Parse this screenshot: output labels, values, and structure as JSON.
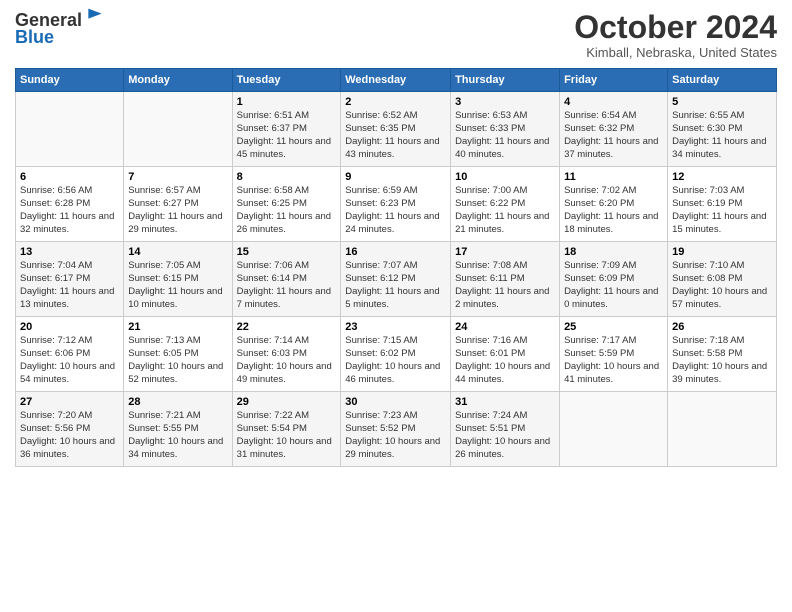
{
  "header": {
    "logo_line1": "General",
    "logo_line2": "Blue",
    "title": "October 2024",
    "location": "Kimball, Nebraska, United States"
  },
  "weekdays": [
    "Sunday",
    "Monday",
    "Tuesday",
    "Wednesday",
    "Thursday",
    "Friday",
    "Saturday"
  ],
  "weeks": [
    [
      {
        "num": "",
        "info": ""
      },
      {
        "num": "",
        "info": ""
      },
      {
        "num": "1",
        "info": "Sunrise: 6:51 AM\nSunset: 6:37 PM\nDaylight: 11 hours and 45 minutes."
      },
      {
        "num": "2",
        "info": "Sunrise: 6:52 AM\nSunset: 6:35 PM\nDaylight: 11 hours and 43 minutes."
      },
      {
        "num": "3",
        "info": "Sunrise: 6:53 AM\nSunset: 6:33 PM\nDaylight: 11 hours and 40 minutes."
      },
      {
        "num": "4",
        "info": "Sunrise: 6:54 AM\nSunset: 6:32 PM\nDaylight: 11 hours and 37 minutes."
      },
      {
        "num": "5",
        "info": "Sunrise: 6:55 AM\nSunset: 6:30 PM\nDaylight: 11 hours and 34 minutes."
      }
    ],
    [
      {
        "num": "6",
        "info": "Sunrise: 6:56 AM\nSunset: 6:28 PM\nDaylight: 11 hours and 32 minutes."
      },
      {
        "num": "7",
        "info": "Sunrise: 6:57 AM\nSunset: 6:27 PM\nDaylight: 11 hours and 29 minutes."
      },
      {
        "num": "8",
        "info": "Sunrise: 6:58 AM\nSunset: 6:25 PM\nDaylight: 11 hours and 26 minutes."
      },
      {
        "num": "9",
        "info": "Sunrise: 6:59 AM\nSunset: 6:23 PM\nDaylight: 11 hours and 24 minutes."
      },
      {
        "num": "10",
        "info": "Sunrise: 7:00 AM\nSunset: 6:22 PM\nDaylight: 11 hours and 21 minutes."
      },
      {
        "num": "11",
        "info": "Sunrise: 7:02 AM\nSunset: 6:20 PM\nDaylight: 11 hours and 18 minutes."
      },
      {
        "num": "12",
        "info": "Sunrise: 7:03 AM\nSunset: 6:19 PM\nDaylight: 11 hours and 15 minutes."
      }
    ],
    [
      {
        "num": "13",
        "info": "Sunrise: 7:04 AM\nSunset: 6:17 PM\nDaylight: 11 hours and 13 minutes."
      },
      {
        "num": "14",
        "info": "Sunrise: 7:05 AM\nSunset: 6:15 PM\nDaylight: 11 hours and 10 minutes."
      },
      {
        "num": "15",
        "info": "Sunrise: 7:06 AM\nSunset: 6:14 PM\nDaylight: 11 hours and 7 minutes."
      },
      {
        "num": "16",
        "info": "Sunrise: 7:07 AM\nSunset: 6:12 PM\nDaylight: 11 hours and 5 minutes."
      },
      {
        "num": "17",
        "info": "Sunrise: 7:08 AM\nSunset: 6:11 PM\nDaylight: 11 hours and 2 minutes."
      },
      {
        "num": "18",
        "info": "Sunrise: 7:09 AM\nSunset: 6:09 PM\nDaylight: 11 hours and 0 minutes."
      },
      {
        "num": "19",
        "info": "Sunrise: 7:10 AM\nSunset: 6:08 PM\nDaylight: 10 hours and 57 minutes."
      }
    ],
    [
      {
        "num": "20",
        "info": "Sunrise: 7:12 AM\nSunset: 6:06 PM\nDaylight: 10 hours and 54 minutes."
      },
      {
        "num": "21",
        "info": "Sunrise: 7:13 AM\nSunset: 6:05 PM\nDaylight: 10 hours and 52 minutes."
      },
      {
        "num": "22",
        "info": "Sunrise: 7:14 AM\nSunset: 6:03 PM\nDaylight: 10 hours and 49 minutes."
      },
      {
        "num": "23",
        "info": "Sunrise: 7:15 AM\nSunset: 6:02 PM\nDaylight: 10 hours and 46 minutes."
      },
      {
        "num": "24",
        "info": "Sunrise: 7:16 AM\nSunset: 6:01 PM\nDaylight: 10 hours and 44 minutes."
      },
      {
        "num": "25",
        "info": "Sunrise: 7:17 AM\nSunset: 5:59 PM\nDaylight: 10 hours and 41 minutes."
      },
      {
        "num": "26",
        "info": "Sunrise: 7:18 AM\nSunset: 5:58 PM\nDaylight: 10 hours and 39 minutes."
      }
    ],
    [
      {
        "num": "27",
        "info": "Sunrise: 7:20 AM\nSunset: 5:56 PM\nDaylight: 10 hours and 36 minutes."
      },
      {
        "num": "28",
        "info": "Sunrise: 7:21 AM\nSunset: 5:55 PM\nDaylight: 10 hours and 34 minutes."
      },
      {
        "num": "29",
        "info": "Sunrise: 7:22 AM\nSunset: 5:54 PM\nDaylight: 10 hours and 31 minutes."
      },
      {
        "num": "30",
        "info": "Sunrise: 7:23 AM\nSunset: 5:52 PM\nDaylight: 10 hours and 29 minutes."
      },
      {
        "num": "31",
        "info": "Sunrise: 7:24 AM\nSunset: 5:51 PM\nDaylight: 10 hours and 26 minutes."
      },
      {
        "num": "",
        "info": ""
      },
      {
        "num": "",
        "info": ""
      }
    ]
  ]
}
